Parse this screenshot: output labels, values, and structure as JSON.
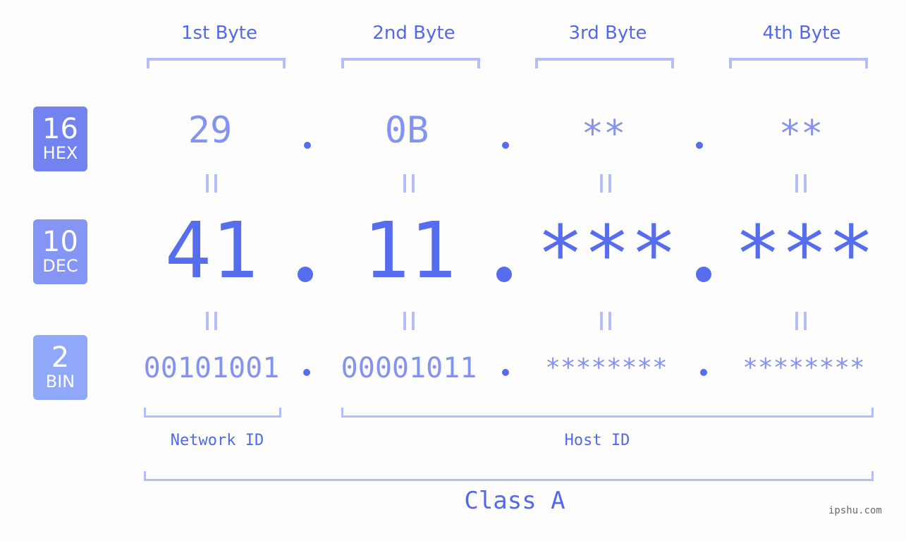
{
  "byte_headers": [
    "1st Byte",
    "2nd Byte",
    "3rd Byte",
    "4th Byte"
  ],
  "badges": {
    "hex": {
      "number": "16",
      "label": "HEX",
      "color": "#7282ee"
    },
    "dec": {
      "number": "10",
      "label": "DEC",
      "color": "#8495f3"
    },
    "bin": {
      "number": "2",
      "label": "BIN",
      "color": "#8fa8fa"
    }
  },
  "hex_values": [
    "29",
    "0B",
    "**",
    "**"
  ],
  "dec_values": [
    "41",
    "11",
    "***",
    "***"
  ],
  "bin_values": [
    "00101001",
    "00001011",
    "********",
    "********"
  ],
  "separator": ".",
  "equals_sign": "=",
  "network_id_label": "Network ID",
  "host_id_label": "Host ID",
  "class_label": "Class A",
  "watermark": "ipshu.com",
  "colors": {
    "accent": "#566ded",
    "light_accent": "#8593ee",
    "bracket": "#b3bdf8",
    "background": "#fcfdfc"
  }
}
